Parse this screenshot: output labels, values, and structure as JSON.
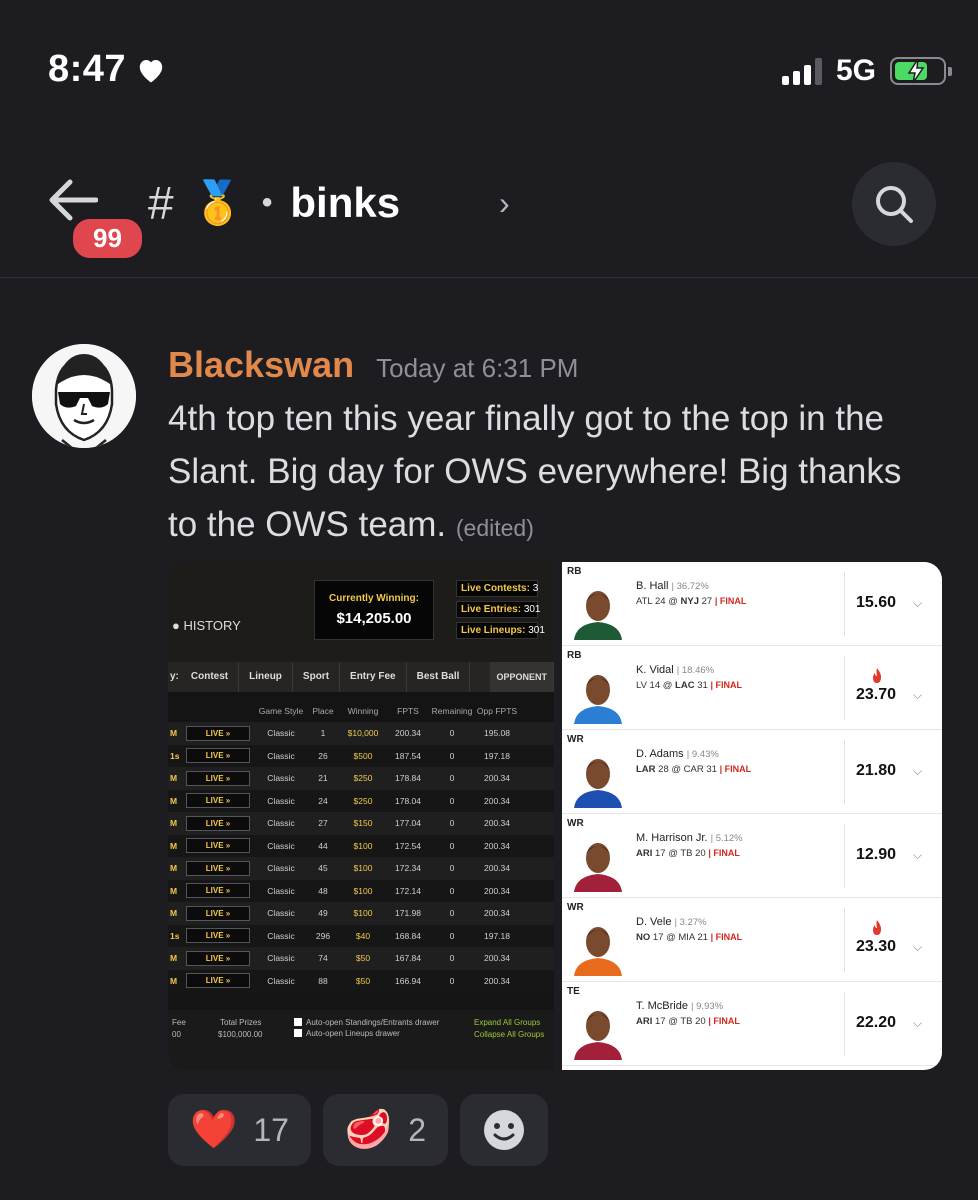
{
  "status_bar": {
    "time": "8:47",
    "network": "5G",
    "icons": [
      "heart-icon",
      "signal-icon",
      "battery-charging-icon"
    ]
  },
  "header": {
    "unread_count": "99",
    "channel_symbol": "#",
    "channel_emoji": "🥇",
    "separator": "•",
    "channel_name": "binks",
    "chevron": "›"
  },
  "message": {
    "author": "Blackswan",
    "author_color": "#e0894a",
    "timestamp": "Today at 6:31 PM",
    "text": "4th top ten this year finally got to the top in the Slant. Big day for OWS everywhere!  Big thanks to the OWS team.",
    "edited": "(edited)"
  },
  "attachment_scoreboard": {
    "currently_winning_label": "Currently Winning:",
    "currently_winning_value": "$14,205.00",
    "live_contests_label": "Live Contests:",
    "live_contests_value": "3",
    "live_entries_label": "Live Entries:",
    "live_entries_value": "301",
    "live_lineups_label": "Live Lineups:",
    "live_lineups_value": "301",
    "history": "HISTORY",
    "tab_prefix": "y:",
    "tabs": [
      "Contest",
      "Lineup",
      "Sport",
      "Entry Fee",
      "Best Ball"
    ],
    "opponent_tab": "OPPONENT",
    "columns": [
      "Game Style",
      "Place",
      "Winning",
      "FPTS",
      "Remaining",
      "Opp FPTS"
    ],
    "rows": [
      {
        "c": "M",
        "live": "LIVE »",
        "style": "Classic",
        "place": "1",
        "win": "$10,000",
        "fpts": "200.34",
        "rem": "0",
        "opp": "195.08"
      },
      {
        "c": "1s",
        "live": "LIVE »",
        "style": "Classic",
        "place": "26",
        "win": "$500",
        "fpts": "187.54",
        "rem": "0",
        "opp": "197.18"
      },
      {
        "c": "M",
        "live": "LIVE »",
        "style": "Classic",
        "place": "21",
        "win": "$250",
        "fpts": "178.84",
        "rem": "0",
        "opp": "200.34"
      },
      {
        "c": "M",
        "live": "LIVE »",
        "style": "Classic",
        "place": "24",
        "win": "$250",
        "fpts": "178.04",
        "rem": "0",
        "opp": "200.34"
      },
      {
        "c": "M",
        "live": "LIVE »",
        "style": "Classic",
        "place": "27",
        "win": "$150",
        "fpts": "177.04",
        "rem": "0",
        "opp": "200.34"
      },
      {
        "c": "M",
        "live": "LIVE »",
        "style": "Classic",
        "place": "44",
        "win": "$100",
        "fpts": "172.54",
        "rem": "0",
        "opp": "200.34"
      },
      {
        "c": "M",
        "live": "LIVE »",
        "style": "Classic",
        "place": "45",
        "win": "$100",
        "fpts": "172.34",
        "rem": "0",
        "opp": "200.34"
      },
      {
        "c": "M",
        "live": "LIVE »",
        "style": "Classic",
        "place": "48",
        "win": "$100",
        "fpts": "172.14",
        "rem": "0",
        "opp": "200.34"
      },
      {
        "c": "M",
        "live": "LIVE »",
        "style": "Classic",
        "place": "49",
        "win": "$100",
        "fpts": "171.98",
        "rem": "0",
        "opp": "200.34"
      },
      {
        "c": "1s",
        "live": "LIVE »",
        "style": "Classic",
        "place": "296",
        "win": "$40",
        "fpts": "168.84",
        "rem": "0",
        "opp": "197.18"
      },
      {
        "c": "M",
        "live": "LIVE »",
        "style": "Classic",
        "place": "74",
        "win": "$50",
        "fpts": "167.84",
        "rem": "0",
        "opp": "200.34"
      },
      {
        "c": "M",
        "live": "LIVE »",
        "style": "Classic",
        "place": "88",
        "win": "$50",
        "fpts": "166.94",
        "rem": "0",
        "opp": "200.34"
      }
    ],
    "footer": {
      "fee_label": "Fee",
      "fee_value": "00",
      "total_prizes_label": "Total Prizes",
      "total_prizes_value": "$100,000.00",
      "auto_open_standings": "Auto-open Standings/Entrants drawer",
      "auto_open_lineups": "Auto-open Lineups drawer",
      "expand_all": "Expand All Groups",
      "collapse_all": "Collapse All Groups"
    }
  },
  "attachment_lineup": {
    "players": [
      {
        "pos": "RB",
        "name": "B. Hall",
        "own": "36.72%",
        "game_pre": "ATL 24 @ ",
        "game_bold": "NYJ",
        "game_post": " 27",
        "final": "FINAL",
        "pts": "15.60",
        "fire": false,
        "jersey": "#1f5a37"
      },
      {
        "pos": "RB",
        "name": "K. Vidal",
        "own": "18.46%",
        "game_pre": "LV 14 @ ",
        "game_bold": "LAC",
        "game_post": " 31",
        "final": "FINAL",
        "pts": "23.70",
        "fire": true,
        "jersey": "#2a7fd4"
      },
      {
        "pos": "WR",
        "name": "D. Adams",
        "own": "9.43%",
        "game_pre": "",
        "game_bold": "LAR",
        "game_post": " 28 @ CAR 31",
        "final": "FINAL",
        "pts": "21.80",
        "fire": false,
        "jersey": "#1d4fb0"
      },
      {
        "pos": "WR",
        "name": "M. Harrison Jr.",
        "own": "5.12%",
        "game_pre": "",
        "game_bold": "ARI",
        "game_post": " 17 @ TB 20",
        "final": "FINAL",
        "pts": "12.90",
        "fire": false,
        "jersey": "#a3203a"
      },
      {
        "pos": "WR",
        "name": "D. Vele",
        "own": "3.27%",
        "game_pre": "",
        "game_bold": "NO",
        "game_post": " 17 @ MIA 21",
        "final": "FINAL",
        "pts": "23.30",
        "fire": true,
        "jersey": "#e86a1c"
      },
      {
        "pos": "TE",
        "name": "T. McBride",
        "own": "9.93%",
        "game_pre": "",
        "game_bold": "ARI",
        "game_post": " 17 @ TB 20",
        "final": "FINAL",
        "pts": "22.20",
        "fire": false,
        "jersey": "#a3203a"
      }
    ]
  },
  "reactions": [
    {
      "emoji": "❤️",
      "icon": "heart-reaction-icon",
      "count": "17"
    },
    {
      "emoji": "🥩",
      "icon": "steak-reaction-icon",
      "count": "2"
    }
  ],
  "add_reaction_icon": "smiley-add-reaction-icon"
}
